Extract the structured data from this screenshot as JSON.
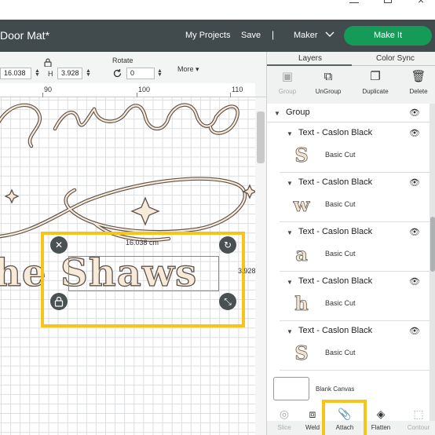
{
  "header": {
    "title": "Door Mat*",
    "my_projects": "My Projects",
    "save": "Save",
    "separator": "|",
    "machine": "Maker",
    "make_it": "Make It"
  },
  "toolbar": {
    "width_value": "16.038",
    "height_label": "H",
    "height_value": "3.928",
    "rotate_label": "Rotate",
    "rotate_value": "0",
    "more": "More"
  },
  "ruler": {
    "labels": [
      "90",
      "100",
      "110"
    ]
  },
  "canvas": {
    "text": "he Shaws",
    "width_readout": "16.038 cm",
    "height_readout": "3.928"
  },
  "panel": {
    "tabs": [
      "Layers",
      "Color Sync"
    ],
    "top_tools": [
      {
        "label": "Group",
        "icon": "group-icon",
        "disabled": true
      },
      {
        "label": "UnGroup",
        "icon": "ungroup-icon",
        "disabled": false
      },
      {
        "label": "Duplicate",
        "icon": "duplicate-icon",
        "disabled": false
      },
      {
        "label": "Delete",
        "icon": "trash-icon",
        "disabled": false
      }
    ],
    "group_label": "Group",
    "layers": [
      {
        "name": "Text - Caslon Black",
        "thumb": "S",
        "op": "Basic Cut"
      },
      {
        "name": "Text - Caslon Black",
        "thumb": "w",
        "op": "Basic Cut"
      },
      {
        "name": "Text - Caslon Black",
        "thumb": "a",
        "op": "Basic Cut"
      },
      {
        "name": "Text - Caslon Black",
        "thumb": "h",
        "op": "Basic Cut"
      },
      {
        "name": "Text - Caslon Black",
        "thumb": "S",
        "op": "Basic Cut"
      }
    ],
    "blank_canvas": "Blank Canvas",
    "bottom_tools": [
      {
        "label": "Slice",
        "icon": "slice-icon",
        "disabled": true
      },
      {
        "label": "Weld",
        "icon": "weld-icon",
        "disabled": false
      },
      {
        "label": "Attach",
        "icon": "paperclip-icon",
        "disabled": false
      },
      {
        "label": "Flatten",
        "icon": "flatten-icon",
        "disabled": false
      },
      {
        "label": "Contour",
        "icon": "contour-icon",
        "disabled": true
      }
    ]
  },
  "colors": {
    "header_bg": "#414a4c",
    "make_button": "#159a58",
    "highlight": "#f5c518",
    "artwork_fill": "#f7ead9"
  }
}
